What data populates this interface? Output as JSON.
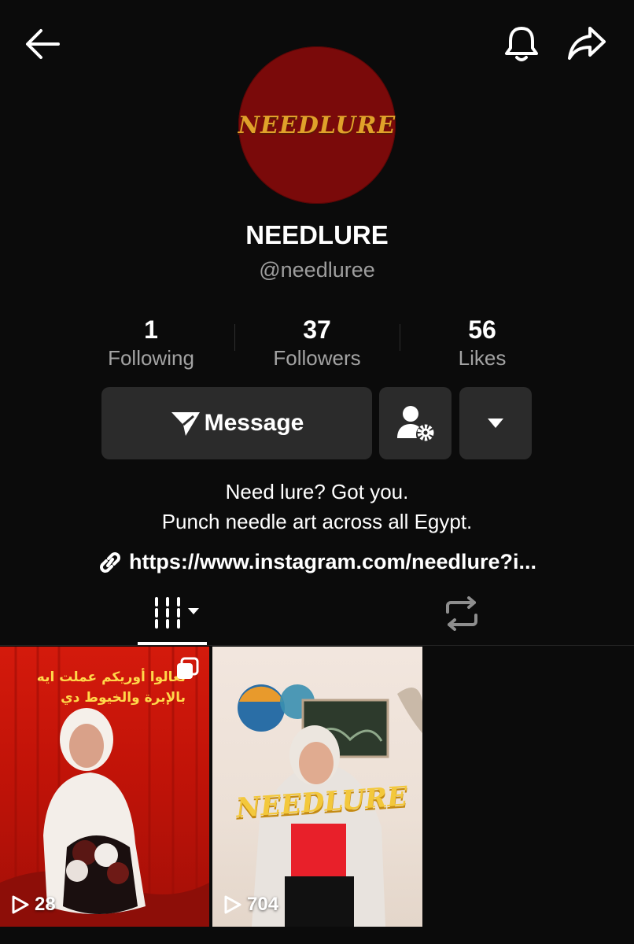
{
  "header": {
    "back_icon": "arrow-left-icon",
    "bell_icon": "bell-icon",
    "share_icon": "share-arrow-icon"
  },
  "profile": {
    "avatar_text": "NEEDLURE",
    "display_name": "NEEDLURE",
    "username": "@needluree"
  },
  "stats": [
    {
      "value": "1",
      "label": "Following"
    },
    {
      "value": "37",
      "label": "Followers"
    },
    {
      "value": "56",
      "label": "Likes"
    }
  ],
  "actions": {
    "message_label": "Message",
    "message_icon": "send-icon",
    "friend_icon": "person-settings-icon",
    "more_icon": "caret-down-icon",
    "button_color": "#2b2b2b"
  },
  "bio": {
    "line1": "Need lure? Got you.",
    "line2": "Punch needle art across all Egypt.",
    "link": "https://www.instagram.com/needlure?i..."
  },
  "tabs": {
    "videos_icon": "grid-columns-icon",
    "reposts_icon": "repost-icon"
  },
  "videos": [
    {
      "overlay_line1": "تعالوا أوريكم عملت ايه",
      "overlay_line2": "بالإبرة والخيوط دي",
      "plays": "28",
      "multi_icon": "multi-photo-icon"
    },
    {
      "overlay_text": "NEEDLURE",
      "plays": "704"
    }
  ],
  "colors": {
    "background": "#0b0b0b",
    "avatar_bg": "#7a0a0a",
    "avatar_text": "#e0a12a",
    "muted_text": "#9e9e9e"
  }
}
